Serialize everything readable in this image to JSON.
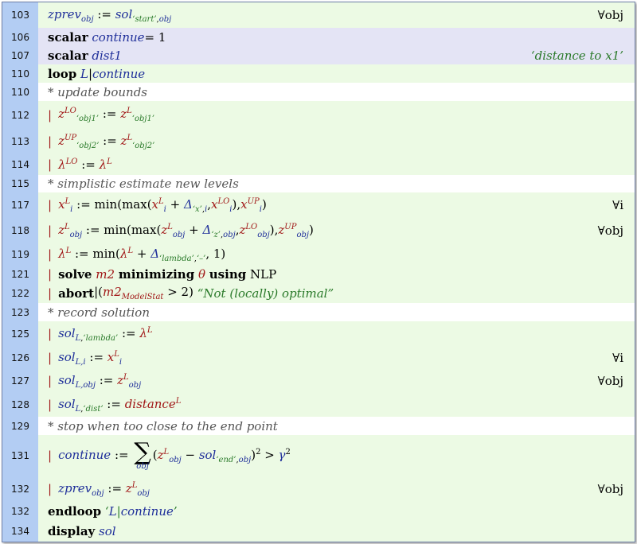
{
  "lines": {
    "l103": {
      "num": "103"
    },
    "l106": {
      "num": "106",
      "kw": "scalar",
      "var": "continue",
      "rhs": " = 1"
    },
    "l107": {
      "num": "107",
      "kw": "scalar",
      "var": "dist1",
      "text": "‘distance to x1’"
    },
    "l110a": {
      "num": "110",
      "kw": "loop"
    },
    "l110b": {
      "num": "110",
      "text": "* update bounds"
    },
    "l112": {
      "num": "112"
    },
    "l113": {
      "num": "113"
    },
    "l114": {
      "num": "114"
    },
    "l115": {
      "num": "115",
      "text": "* simplistic estimate new levels"
    },
    "l117": {
      "num": "117"
    },
    "l118": {
      "num": "118"
    },
    "l119": {
      "num": "119"
    },
    "l121": {
      "num": "121",
      "solve": "solve",
      "minimizing": "minimizing",
      "using": "using",
      "nlp": "NLP"
    },
    "l122": {
      "num": "122",
      "kw": "abort",
      "msg": "“Not (locally) optimal”"
    },
    "l123": {
      "num": "123",
      "text": "* record solution"
    },
    "l125": {
      "num": "125"
    },
    "l126": {
      "num": "126"
    },
    "l127": {
      "num": "127"
    },
    "l128": {
      "num": "128"
    },
    "l129": {
      "num": "129",
      "text": "* stop when too close to the end point"
    },
    "l131": {
      "num": "131"
    },
    "l132a": {
      "num": "132"
    },
    "l132b": {
      "num": "132",
      "kw": "endloop"
    },
    "l134": {
      "num": "134",
      "kw": "display",
      "var": "sol"
    }
  },
  "symbols": {
    "forall_obj": "∀obj",
    "forall_i": "∀i",
    "assign": ":=",
    "pipe": "|"
  },
  "colors": {
    "gutter": "#b3cdf3",
    "green_row": "#ecfae4",
    "blue_row": "#e4e4f5",
    "variable": "#1f2f9a",
    "parameter": "#a11818",
    "string": "#2a7a2a"
  }
}
